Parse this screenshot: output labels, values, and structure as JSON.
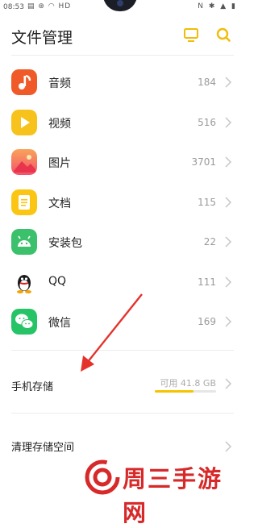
{
  "status_bar": {
    "time": "08:53",
    "left_icons": "▤ ⊛ ◠ HD",
    "right_icons": "N ✱ ▲ ▮"
  },
  "header": {
    "title": "文件管理"
  },
  "categories": [
    {
      "label": "音频",
      "count": "184",
      "icon": "music-icon",
      "color": "#f05a28"
    },
    {
      "label": "视频",
      "count": "516",
      "icon": "play-icon",
      "color": "#f7c21b"
    },
    {
      "label": "图片",
      "count": "3701",
      "icon": "picture-icon",
      "color": "#f56a6a"
    },
    {
      "label": "文档",
      "count": "115",
      "icon": "document-icon",
      "color": "#fbc513"
    },
    {
      "label": "安装包",
      "count": "22",
      "icon": "android-icon",
      "color": "#3bc16c"
    },
    {
      "label": "QQ",
      "count": "111",
      "icon": "qq-penguin-icon",
      "color": "#ffffff"
    },
    {
      "label": "微信",
      "count": "169",
      "icon": "wechat-icon",
      "color": "#27c467"
    }
  ],
  "storage": {
    "label": "手机存储",
    "available": "可用 41.8 GB",
    "used_fraction": 0.63
  },
  "clean": {
    "label": "清理存储空间"
  },
  "watermark": {
    "text": "周三手游网"
  },
  "colors": {
    "accent": "#f5c400",
    "arrow": "#e4322b",
    "watermark": "#d7292a"
  }
}
